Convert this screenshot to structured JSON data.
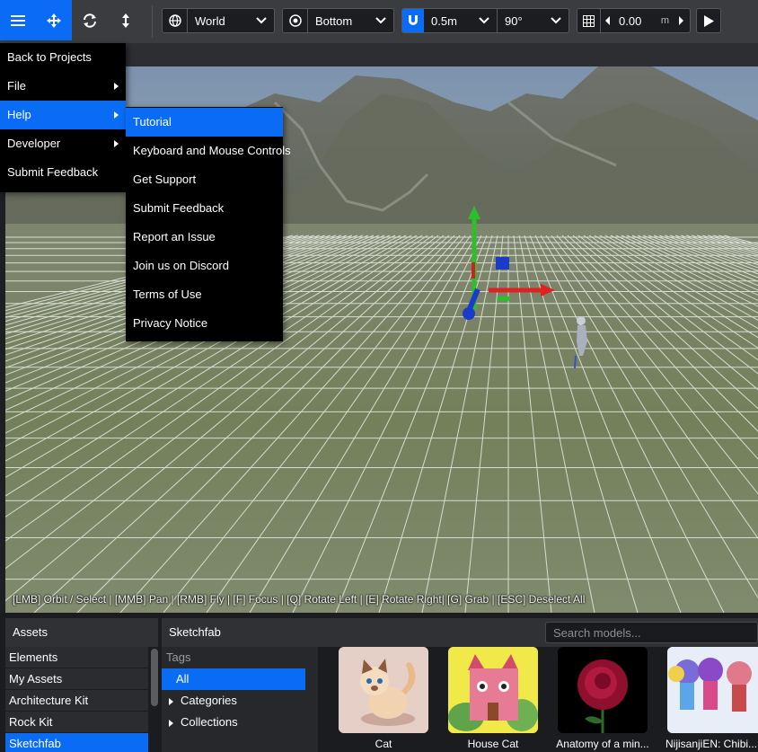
{
  "toolbar": {
    "space": "World",
    "pivot": "Bottom",
    "snap_distance": "0.5m",
    "snap_angle": "90°",
    "grid_value": "0.00",
    "grid_unit": "m"
  },
  "main_menu": {
    "items": [
      {
        "label": "Back to Projects"
      },
      {
        "label": "File"
      },
      {
        "label": "Help"
      },
      {
        "label": "Developer"
      },
      {
        "label": "Submit Feedback"
      }
    ]
  },
  "help_menu": {
    "items": [
      {
        "label": "Tutorial"
      },
      {
        "label": "Keyboard and Mouse Controls"
      },
      {
        "label": "Get Support"
      },
      {
        "label": "Submit Feedback"
      },
      {
        "label": "Report an Issue"
      },
      {
        "label": "Join us on Discord"
      },
      {
        "label": "Terms of Use"
      },
      {
        "label": "Privacy Notice"
      }
    ]
  },
  "viewport": {
    "hint": "[LMB] Orbit / Select | [MMB] Pan | [RMB] Fly | [F] Focus | [Q] Rotate Left | [E] Rotate Right| [G] Grab | [ESC] Deselect All"
  },
  "assets_panel": {
    "title": "Assets",
    "items": [
      {
        "label": "Elements"
      },
      {
        "label": "My Assets"
      },
      {
        "label": "Architecture Kit"
      },
      {
        "label": "Rock Kit"
      },
      {
        "label": "Sketchfab"
      }
    ]
  },
  "sketchfab": {
    "title": "Sketchfab",
    "search_placeholder": "Search models...",
    "tags_title": "Tags",
    "tags": [
      {
        "label": "All"
      },
      {
        "label": "Categories"
      },
      {
        "label": "Collections"
      }
    ],
    "models": [
      {
        "label": "Cat"
      },
      {
        "label": "House Cat"
      },
      {
        "label": "Anatomy of a min..."
      },
      {
        "label": "NijisanjiEN: Chibi..."
      }
    ]
  },
  "colors": {
    "accent": "#0a6cf5",
    "toolbar_bg": "#3a3c40",
    "menu_bg": "#000000",
    "panel_bg": "#1b1c1f"
  }
}
